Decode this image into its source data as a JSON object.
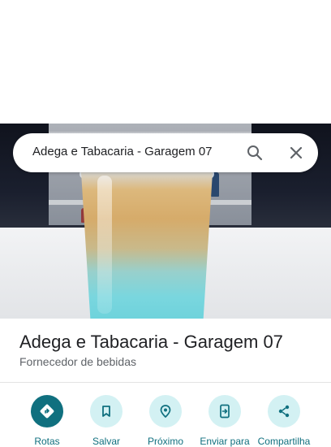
{
  "search": {
    "query": "Adega e Tabacaria - Garagem 07"
  },
  "place": {
    "title": "Adega e Tabacaria - Garagem 07",
    "category": "Fornecedor de bebidas"
  },
  "actions": [
    {
      "label": "Rotas",
      "icon": "directions-icon"
    },
    {
      "label": "Salvar",
      "icon": "bookmark-icon"
    },
    {
      "label": "Próximo",
      "icon": "nearby-icon"
    },
    {
      "label": "Enviar para",
      "icon": "send-to-phone-icon"
    },
    {
      "label": "Compartilha",
      "icon": "share-icon"
    }
  ],
  "colors": {
    "accent": "#10707f",
    "action_bg": "#d3f1f3",
    "title": "#202124",
    "secondary": "#5f6368"
  }
}
